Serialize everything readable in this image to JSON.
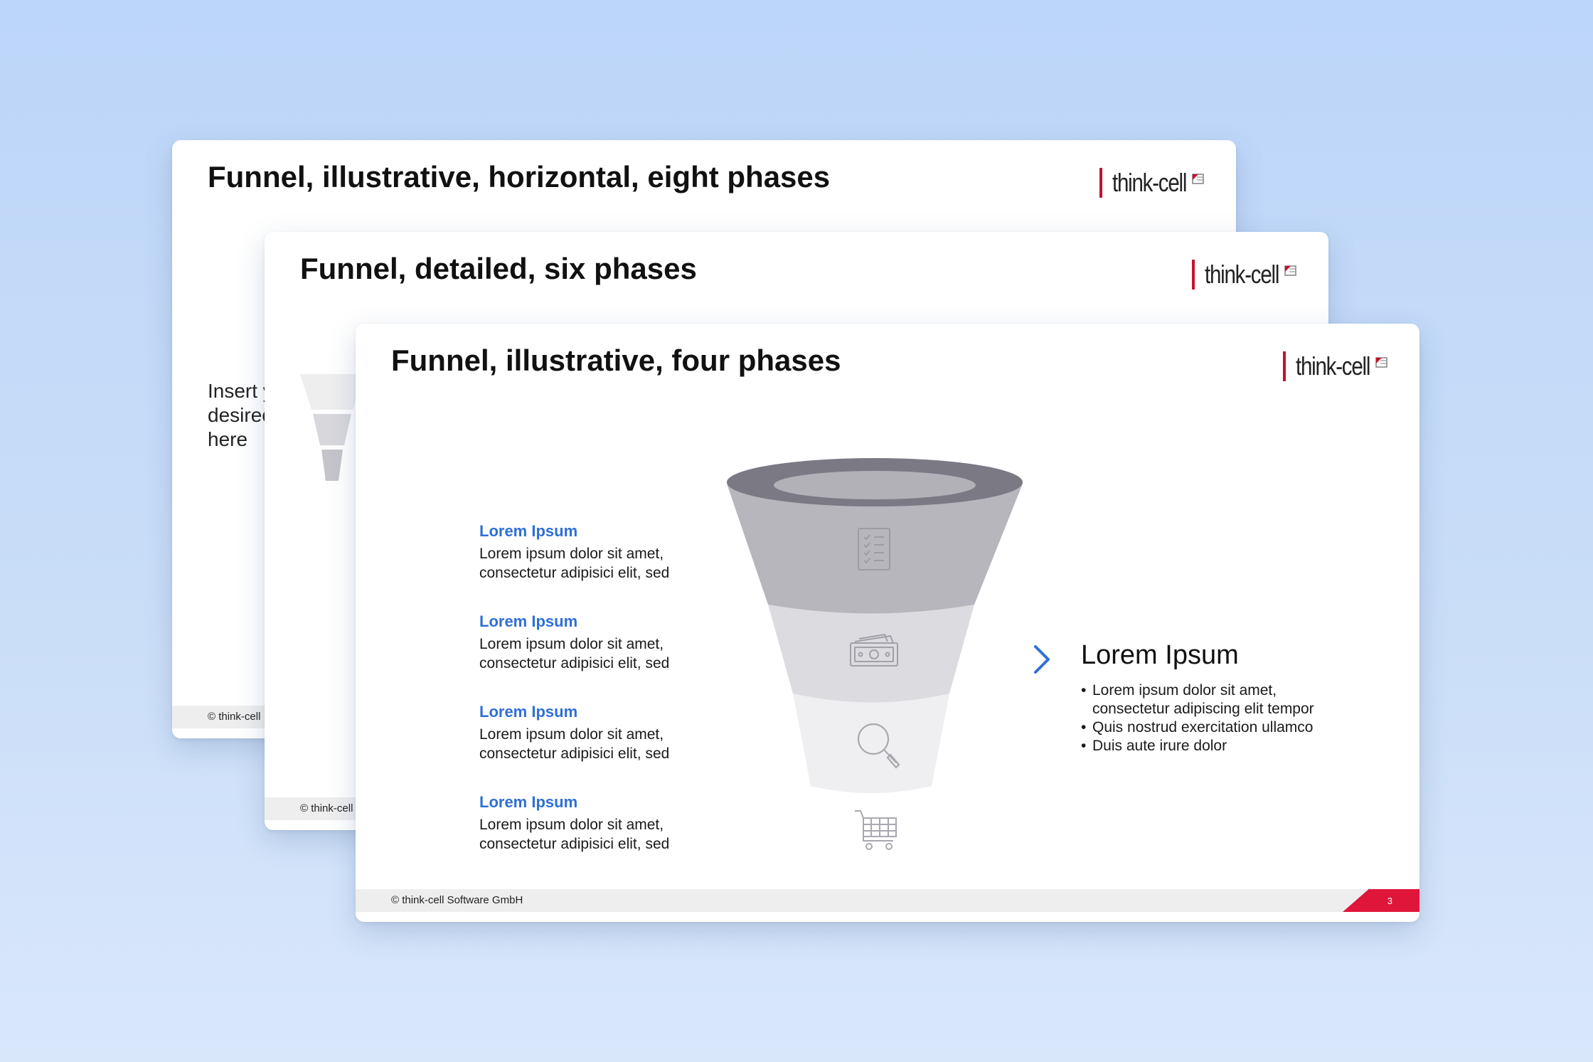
{
  "brand": {
    "logo_text": "think-cell",
    "accent_color": "#c8102e",
    "link_color": "#2f6fd6"
  },
  "slides": [
    {
      "title": "Funnel, illustrative, horizontal, eight phases",
      "body_visible": "Insert y\ndesirec\nhere",
      "footer": "© think-cell"
    },
    {
      "title": "Funnel, detailed, six phases",
      "footer": "© think-cell"
    },
    {
      "title": "Funnel, illustrative, four phases",
      "footer": "© think-cell Software GmbH",
      "page_number": "3",
      "phases": [
        {
          "title": "Lorem Ipsum",
          "text": "Lorem ipsum dolor sit amet, consectetur adipisici elit, sed",
          "icon": "checklist-icon"
        },
        {
          "title": "Lorem Ipsum",
          "text": "Lorem ipsum dolor sit amet, consectetur adipisici elit, sed",
          "icon": "money-icon"
        },
        {
          "title": "Lorem Ipsum",
          "text": "Lorem ipsum dolor sit amet, consectetur adipisici elit, sed",
          "icon": "magnifier-icon"
        },
        {
          "title": "Lorem Ipsum",
          "text": "Lorem ipsum dolor sit amet, consectetur adipisici elit, sed",
          "icon": "shopping-cart-icon"
        }
      ],
      "summary": {
        "heading": "Lorem Ipsum",
        "bullets": [
          "Lorem ipsum dolor sit amet, consectetur adipiscing elit tempor",
          "Quis nostrud exercitation ullamco",
          "Duis aute irure dolor"
        ]
      }
    }
  ]
}
